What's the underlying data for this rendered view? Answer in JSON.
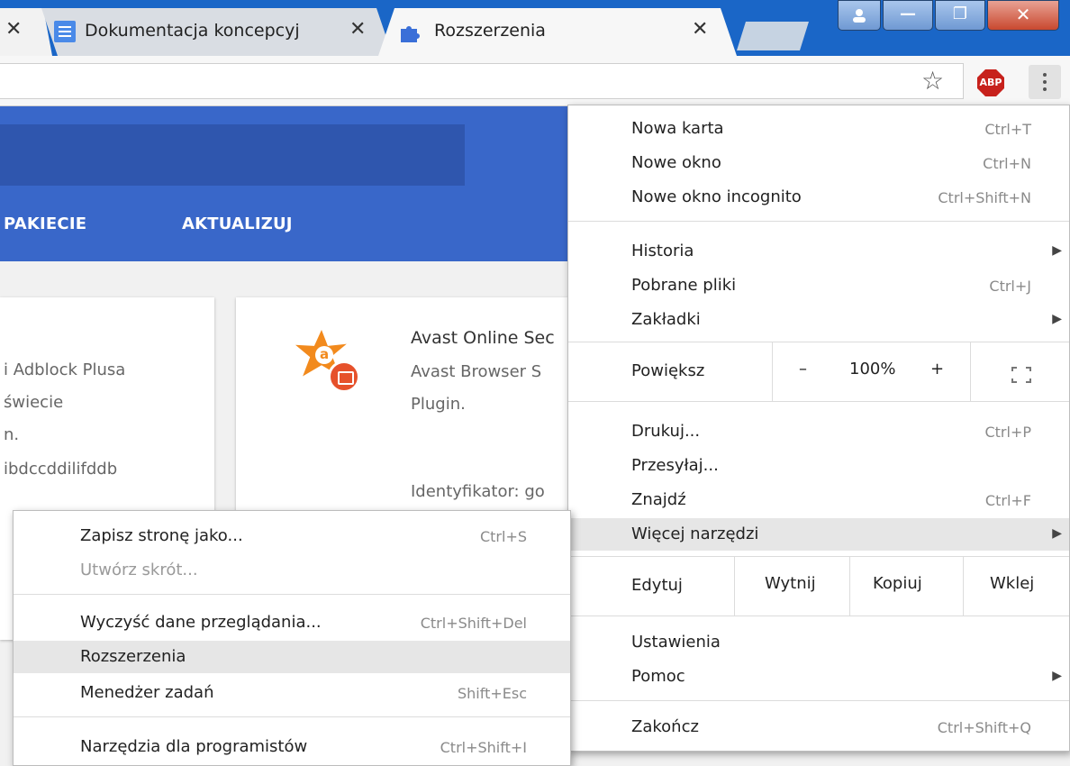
{
  "tabs": [
    {
      "title": "",
      "close": "✕"
    },
    {
      "title": "Dokumentacja koncepcyj",
      "close": "✕"
    },
    {
      "title": "Rozszerzenia",
      "close": "✕"
    }
  ],
  "window_controls": {
    "minimize": "—",
    "maximize": "❐",
    "close": "✕"
  },
  "toolbar": {
    "star": "☆",
    "abp": "ABP"
  },
  "page": {
    "nav": [
      "PAKIECIE",
      "AKTUALIZUJ"
    ],
    "left_card": {
      "lines": [
        "i Adblock Plusa",
        "świecie",
        "n.",
        "ibdccddilifddb"
      ]
    },
    "right_card": {
      "title": "Avast Online Sec",
      "desc_lines": [
        "Avast Browser S",
        "Plugin."
      ],
      "id_label": "Identyfikator: go",
      "logo_letter": "a"
    }
  },
  "main_menu": {
    "new_tab": {
      "label": "Nowa karta",
      "shortcut": "Ctrl+T"
    },
    "new_window": {
      "label": "Nowe okno",
      "shortcut": "Ctrl+N"
    },
    "incognito": {
      "label": "Nowe okno incognito",
      "shortcut": "Ctrl+Shift+N"
    },
    "history": {
      "label": "Historia",
      "arrow": "▶"
    },
    "downloads": {
      "label": "Pobrane pliki",
      "shortcut": "Ctrl+J"
    },
    "bookmarks": {
      "label": "Zakładki",
      "arrow": "▶"
    },
    "zoom": {
      "label": "Powiększ",
      "minus": "–",
      "value": "100%",
      "plus": "+"
    },
    "print": {
      "label": "Drukuj...",
      "shortcut": "Ctrl+P"
    },
    "cast": {
      "label": "Przesyłaj..."
    },
    "find": {
      "label": "Znajdź",
      "shortcut": "Ctrl+F"
    },
    "more_tools": {
      "label": "Więcej narzędzi",
      "arrow": "▶"
    },
    "edit": {
      "label": "Edytuj",
      "cut": "Wytnij",
      "copy": "Kopiuj",
      "paste": "Wklej"
    },
    "settings": {
      "label": "Ustawienia"
    },
    "help": {
      "label": "Pomoc",
      "arrow": "▶"
    },
    "exit": {
      "label": "Zakończ",
      "shortcut": "Ctrl+Shift+Q"
    }
  },
  "sub_menu": {
    "save_page": {
      "label": "Zapisz stronę jako...",
      "shortcut": "Ctrl+S"
    },
    "create_shortcut": {
      "label": "Utwórz skrót..."
    },
    "clear_data": {
      "label": "Wyczyść dane przeglądania...",
      "shortcut": "Ctrl+Shift+Del"
    },
    "extensions": {
      "label": "Rozszerzenia"
    },
    "task_manager": {
      "label": "Menedżer zadań",
      "shortcut": "Shift+Esc"
    },
    "dev_tools": {
      "label": "Narzędzia dla programistów",
      "shortcut": "Ctrl+Shift+I"
    }
  }
}
